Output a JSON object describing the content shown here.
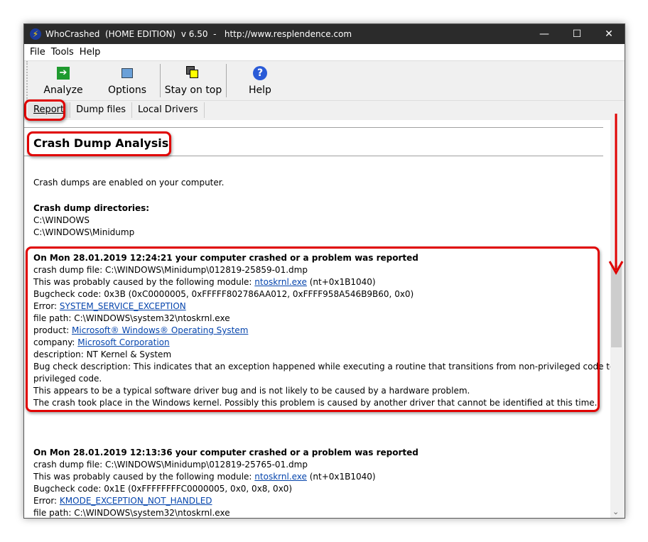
{
  "window": {
    "title": "WhoCrashed  (HOME EDITION)  v 6.50  -   http://www.resplendence.com",
    "minimize": "—",
    "maximize": "☐",
    "close": "✕"
  },
  "menu": [
    "File",
    "Tools",
    "Help"
  ],
  "toolbar": {
    "analyze": "Analyze",
    "options": "Options",
    "stay_on_top": "Stay on top",
    "help": "Help"
  },
  "tabs": [
    "Report",
    "Dump files",
    "Local Drivers"
  ],
  "report": {
    "heading": "Crash Dump Analysis",
    "enabled": "Crash dumps are enabled on your computer.",
    "dirs_label": "Crash dump directories:",
    "dirs": [
      "C:\\WINDOWS",
      "C:\\WINDOWS\\Minidump"
    ],
    "crashes": [
      {
        "title": "On Mon 28.01.2019 12:24:21 your computer crashed or a problem was reported",
        "dump": "crash dump file: C:\\WINDOWS\\Minidump\\012819-25859-01.dmp",
        "cause_prefix": "This was probably caused by the following module: ",
        "module": "ntoskrnl.exe",
        "cause_suffix": " (nt+0x1B1040)",
        "bugcheck": "Bugcheck code: 0x3B (0xC0000005, 0xFFFFF802786AA012, 0xFFFF958A546B9B60, 0x0)",
        "error_prefix": "Error: ",
        "error": "SYSTEM_SERVICE_EXCEPTION",
        "path": "file path: C:\\WINDOWS\\system32\\ntoskrnl.exe",
        "product_prefix": "product: ",
        "product": "Microsoft® Windows® Operating System",
        "company_prefix": "company: ",
        "company": "Microsoft Corporation",
        "description": "description: NT Kernel & System",
        "bugcheck_desc1": "Bug check description: This indicates that an exception happened while executing a routine that transitions from non-privileged code to",
        "bugcheck_desc2": "privileged code.",
        "note1": "This appears to be a typical software driver bug and is not likely to be caused by a hardware problem.",
        "note2": "The crash took place in the Windows kernel. Possibly this problem is caused by another driver that cannot be identified at this time."
      },
      {
        "title": "On Mon 28.01.2019 12:13:36 your computer crashed or a problem was reported",
        "dump": "crash dump file: C:\\WINDOWS\\Minidump\\012819-25765-01.dmp",
        "cause_prefix": "This was probably caused by the following module: ",
        "module": "ntoskrnl.exe",
        "cause_suffix": " (nt+0x1B1040)",
        "bugcheck": "Bugcheck code: 0x1E (0xFFFFFFFFC0000005, 0x0, 0x8, 0x0)",
        "error_prefix": "Error: ",
        "error": "KMODE_EXCEPTION_NOT_HANDLED",
        "path": "file path: C:\\WINDOWS\\system32\\ntoskrnl.exe"
      }
    ]
  },
  "colors": {
    "annotation": "#e00000",
    "link": "#0645ad",
    "titlebar": "#2b2b2b"
  }
}
